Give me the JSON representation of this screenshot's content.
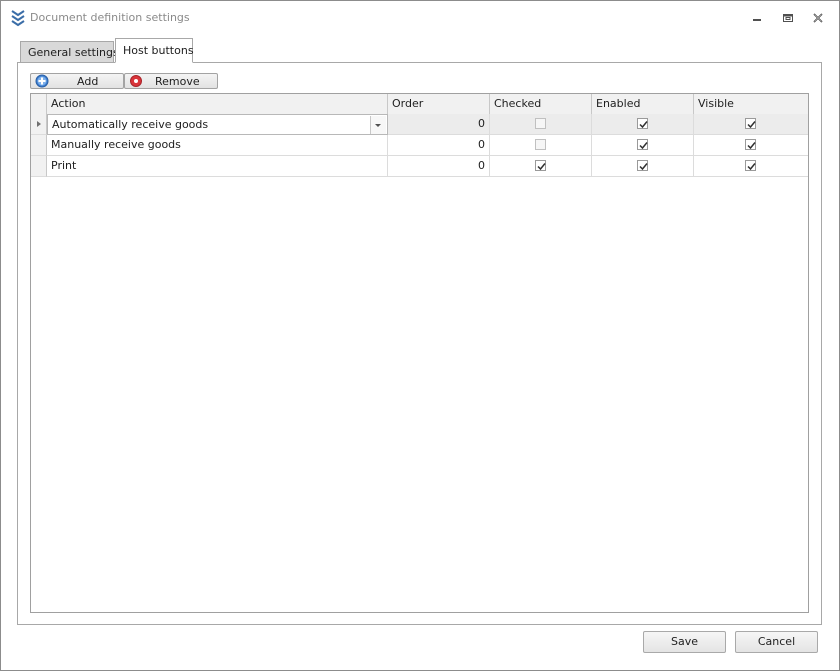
{
  "window": {
    "title": "Document definition settings"
  },
  "tabs": [
    {
      "label": "General settings",
      "active": false
    },
    {
      "label": "Host buttons",
      "active": true
    }
  ],
  "toolbar": {
    "add_label": "Add",
    "remove_label": "Remove"
  },
  "grid": {
    "columns": [
      "Action",
      "Order",
      "Checked",
      "Enabled",
      "Visible"
    ],
    "rows": [
      {
        "action": "Automatically receive goods",
        "order": "0",
        "checked": false,
        "enabled": true,
        "visible": true,
        "selected": true
      },
      {
        "action": "Manually receive goods",
        "order": "0",
        "checked": false,
        "enabled": true,
        "visible": true,
        "selected": false
      },
      {
        "action": "Print",
        "order": "0",
        "checked": true,
        "enabled": true,
        "visible": true,
        "selected": false
      }
    ]
  },
  "footer": {
    "save_label": "Save",
    "cancel_label": "Cancel"
  },
  "icons": {
    "app": "stacked-chevrons-icon",
    "add": "plus-circle-icon",
    "remove": "record-stop-icon"
  },
  "colors": {
    "app_icon": "#3b6ea8",
    "add_icon": "#3d7fd1",
    "remove_icon": "#d9343a"
  }
}
